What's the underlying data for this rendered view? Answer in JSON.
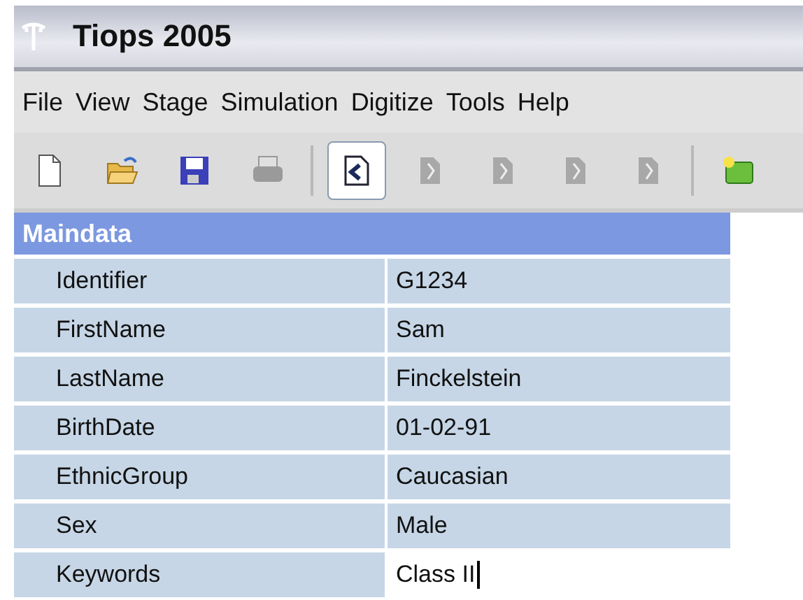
{
  "window": {
    "title": "Tiops 2005"
  },
  "menu": [
    "File",
    "View",
    "Stage",
    "Simulation",
    "Digitize",
    "Tools",
    "Help"
  ],
  "toolbar_groups": [
    [
      {
        "kind": "new",
        "disabled": false,
        "selected": false
      },
      {
        "kind": "open",
        "disabled": false,
        "selected": false
      },
      {
        "kind": "save",
        "disabled": false,
        "selected": false
      },
      {
        "kind": "print",
        "disabled": true,
        "selected": false
      }
    ],
    [
      {
        "kind": "page-back",
        "disabled": false,
        "selected": true
      },
      {
        "kind": "page",
        "disabled": true,
        "selected": false
      },
      {
        "kind": "page",
        "disabled": true,
        "selected": false
      },
      {
        "kind": "page",
        "disabled": true,
        "selected": false
      },
      {
        "kind": "page",
        "disabled": true,
        "selected": false
      }
    ],
    [
      {
        "kind": "add",
        "disabled": false,
        "selected": false
      }
    ]
  ],
  "grid": {
    "header": "Maindata",
    "rows": [
      {
        "name": "Identifier",
        "value": "G1234",
        "editing": false
      },
      {
        "name": "FirstName",
        "value": "Sam",
        "editing": false
      },
      {
        "name": "LastName",
        "value": "Finckelstein",
        "editing": false
      },
      {
        "name": "BirthDate",
        "value": "01-02-91",
        "editing": false
      },
      {
        "name": "EthnicGroup",
        "value": "Caucasian",
        "editing": false
      },
      {
        "name": "Sex",
        "value": "Male",
        "editing": false
      },
      {
        "name": "Keywords",
        "value": "Class II",
        "editing": true
      }
    ]
  }
}
